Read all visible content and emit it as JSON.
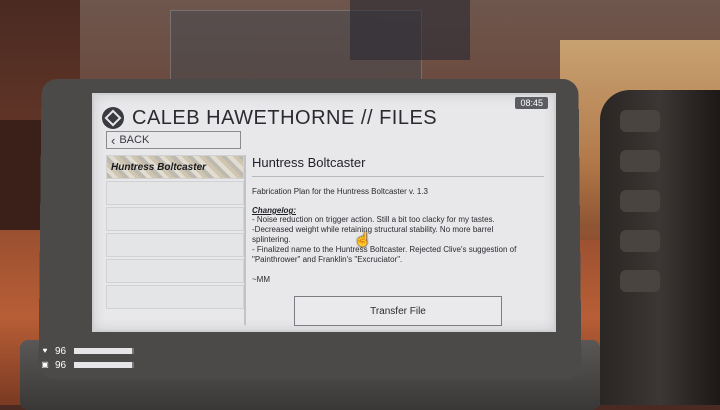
{
  "screen": {
    "clock": "08:45",
    "title": "CALEB HAWETHORNE // FILES",
    "back_label": "BACK",
    "list": {
      "items": [
        {
          "label": "Huntress Boltcaster",
          "selected": true
        },
        {
          "label": ""
        },
        {
          "label": ""
        },
        {
          "label": ""
        },
        {
          "label": ""
        },
        {
          "label": ""
        }
      ]
    },
    "detail": {
      "title": "Huntress Boltcaster",
      "subtitle": "Fabrication Plan for the Huntress Boltcaster v. 1.3",
      "changelog_heading": "Changelog:",
      "lines": [
        "- Noise reduction on trigger action. Still a bit too clacky for my tastes.",
        "-Decreased weight while retaining structural stability. No more barrel",
        "splintering.",
        "- Finalized name to the Huntress Boltcaster. Rejected Clive's suggestion of",
        "\"Painthrower\" and Franklin's \"Excruciator\"."
      ],
      "signature": "~MM",
      "transfer_label": "Transfer File"
    }
  },
  "hud": {
    "health": {
      "icon": "heartbeat-icon",
      "value": "96",
      "fill": 0.96
    },
    "armor": {
      "icon": "armor-icon",
      "value": "96",
      "fill": 0.96
    }
  }
}
